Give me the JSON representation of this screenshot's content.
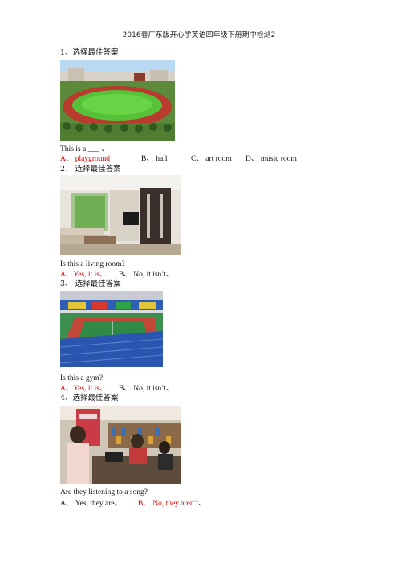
{
  "header": "2016春广东版开心学英语四年级下册期中检测2",
  "questions": [
    {
      "title": "1、选择最佳答案",
      "prompt": "This is a ___ 、",
      "options": [
        "A、 playground",
        "B、 hall",
        "C、 art room",
        "D、 music room"
      ],
      "answer_index": 0
    },
    {
      "title": "2、 选择最佳答案",
      "prompt": "Is this a living room?",
      "options": [
        "A、Yes, it is、",
        "B、 No, it isn’t、"
      ],
      "answer_index": 0
    },
    {
      "title": "3、 选择最佳答案",
      "prompt": "Is this a gym?",
      "options": [
        "A、Yes, it is、",
        "B、 No, it isn’t、"
      ],
      "answer_index": 0
    },
    {
      "title": "4、选择最佳答案",
      "prompt": "Are they listening to a song?",
      "options": [
        "A、 Yes, they are、",
        "B、 No, they aren’t、"
      ],
      "answer_index": 1
    }
  ],
  "colors": {
    "answer": "#d80000",
    "text": "#111111"
  }
}
